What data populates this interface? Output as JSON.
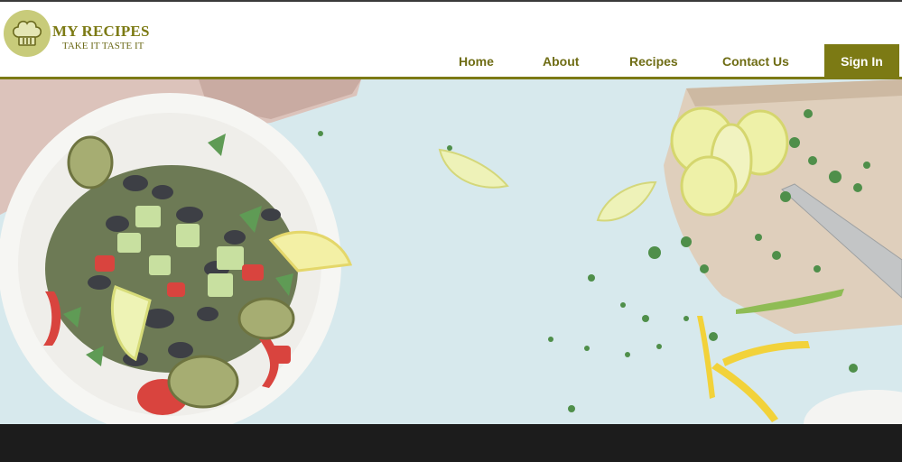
{
  "brand": {
    "title": "MY RECIPES",
    "tagline": "TAKE IT TASTE IT",
    "logo_icon": "chef-hat-icon"
  },
  "nav": {
    "items": [
      {
        "label": "Home"
      },
      {
        "label": "About"
      },
      {
        "label": "Recipes"
      },
      {
        "label": "Contact Us"
      }
    ],
    "sign_in_label": "Sign In"
  },
  "hero": {
    "image": "salad-bowl-lemons-cutting-board-photo"
  },
  "colors": {
    "accent": "#7c7a14",
    "logo_background": "#c8cb7a",
    "footer": "#1c1c1c",
    "hero_background": "#d6e8ec"
  }
}
